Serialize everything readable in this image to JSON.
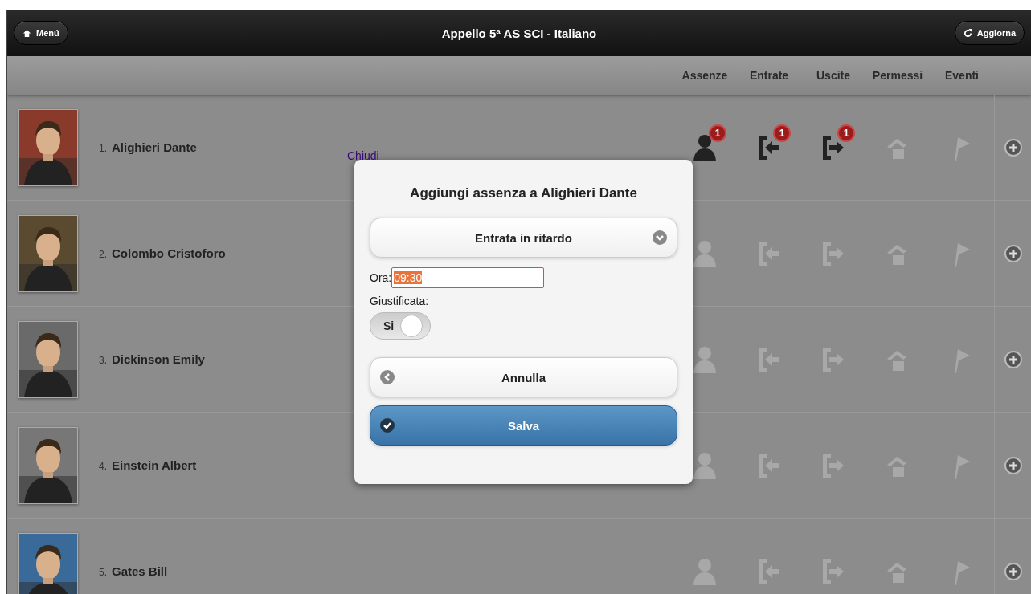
{
  "header": {
    "menu_button": "Menú",
    "title": "Appello 5ª AS SCI - Italiano",
    "refresh_button": "Aggiorna"
  },
  "columns": [
    "Assenze",
    "Entrate",
    "Uscite",
    "Permessi",
    "Eventi"
  ],
  "rows": [
    {
      "number": "1.",
      "name": "Alighieri Dante",
      "marks": [
        {
          "kind": "absence",
          "active": true,
          "badge": "1"
        },
        {
          "kind": "entry",
          "active": true,
          "badge": "1"
        },
        {
          "kind": "exit",
          "active": true,
          "badge": "1"
        },
        {
          "kind": "permission",
          "active": false
        },
        {
          "kind": "event",
          "active": false
        }
      ]
    },
    {
      "number": "2.",
      "name": "Colombo Cristoforo",
      "marks": [
        {
          "kind": "absence",
          "active": false
        },
        {
          "kind": "entry",
          "active": false
        },
        {
          "kind": "exit",
          "active": false
        },
        {
          "kind": "permission",
          "active": false
        },
        {
          "kind": "event",
          "active": false
        }
      ]
    },
    {
      "number": "3.",
      "name": "Dickinson Emily",
      "marks": [
        {
          "kind": "absence",
          "active": false
        },
        {
          "kind": "entry",
          "active": false
        },
        {
          "kind": "exit",
          "active": false
        },
        {
          "kind": "permission",
          "active": false
        },
        {
          "kind": "event",
          "active": false
        }
      ]
    },
    {
      "number": "4.",
      "name": "Einstein Albert",
      "marks": [
        {
          "kind": "absence",
          "active": false
        },
        {
          "kind": "entry",
          "active": false
        },
        {
          "kind": "exit",
          "active": false
        },
        {
          "kind": "permission",
          "active": false
        },
        {
          "kind": "event",
          "active": false
        }
      ]
    },
    {
      "number": "5.",
      "name": "Gates Bill",
      "marks": [
        {
          "kind": "absence",
          "active": false
        },
        {
          "kind": "entry",
          "active": false
        },
        {
          "kind": "exit",
          "active": false
        },
        {
          "kind": "permission",
          "active": false
        },
        {
          "kind": "event",
          "active": false
        }
      ]
    }
  ],
  "dialog": {
    "close_link": "Chiudi",
    "title": "Aggiungi assenza a Alighieri Dante",
    "type_select": "Entrata in ritardo",
    "time_label": "Ora:",
    "time_value": "09:30",
    "justified_label": "Giustificata:",
    "justified_toggle": {
      "label": "Si",
      "on": true
    },
    "cancel_button": "Annulla",
    "save_button": "Salva"
  }
}
